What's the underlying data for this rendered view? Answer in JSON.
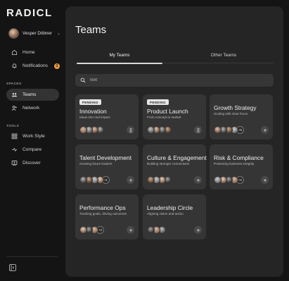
{
  "app": {
    "logo": "RADICL"
  },
  "user": {
    "name": "Vesper Döbner"
  },
  "nav": {
    "home": "Home",
    "notifications": "Notifications",
    "notifications_count": "3",
    "spaces_label": "SPACES",
    "teams": "Teams",
    "network": "Network",
    "tools_label": "TOOLS",
    "work_style": "Work Style",
    "compare": "Compare",
    "discover": "Discover"
  },
  "page": {
    "title": "Teams"
  },
  "tabs": {
    "my_teams": "My Teams",
    "other_teams": "Other Teams"
  },
  "search": {
    "placeholder": "Text"
  },
  "teams": [
    {
      "status": "PENDING",
      "name": "Innovation",
      "subtitle": "Ideas into real impact",
      "extra": "",
      "action": "pending"
    },
    {
      "status": "PENDING",
      "name": "Product Launch",
      "subtitle": "From concept to market",
      "extra": "",
      "action": "pending"
    },
    {
      "status": "",
      "name": "Growth Strategy",
      "subtitle": "Scaling with clear focus",
      "extra": "+5",
      "action": "add"
    },
    {
      "status": "",
      "name": "Talent Development",
      "subtitle": "Growing future leaders",
      "extra": "+1",
      "action": "add"
    },
    {
      "status": "",
      "name": "Culture & Engagement",
      "subtitle": "Building stronger connections",
      "extra": "",
      "action": "add"
    },
    {
      "status": "",
      "name": "Risk & Compliance",
      "subtitle": "Protecting business integrity",
      "extra": "+2",
      "action": "add"
    },
    {
      "status": "",
      "name": "Performance Ops",
      "subtitle": "Tracking goals, driving outcomes",
      "extra": "+2",
      "action": "add"
    },
    {
      "status": "",
      "name": "Leadership Circle",
      "subtitle": "Aligning vision and action",
      "extra": "",
      "action": "add"
    }
  ],
  "colors": {
    "accent_badge": "#e89a3c",
    "panel": "#252525",
    "card": "#353535",
    "sidebar": "#141414"
  }
}
